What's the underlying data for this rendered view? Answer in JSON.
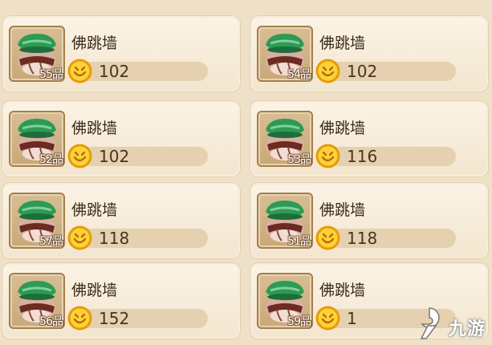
{
  "items": [
    {
      "name": "佛跳墙",
      "grade": "55品",
      "price": "102"
    },
    {
      "name": "佛跳墙",
      "grade": "54品",
      "price": "102"
    },
    {
      "name": "佛跳墙",
      "grade": "52品",
      "price": "102"
    },
    {
      "name": "佛跳墙",
      "grade": "53品",
      "price": "116"
    },
    {
      "name": "佛跳墙",
      "grade": "57品",
      "price": "118"
    },
    {
      "name": "佛跳墙",
      "grade": "51品",
      "price": "118"
    },
    {
      "name": "佛跳墙",
      "grade": "56品",
      "price": "152"
    },
    {
      "name": "佛跳墙",
      "grade": "59品",
      "price": "1"
    }
  ],
  "watermark": {
    "text": "九游"
  },
  "icons": {
    "item": "clay-pot-icon",
    "currency": "gold-coin-icon",
    "watermark_logo": "nine-game-logo-icon"
  },
  "colors": {
    "card_bg": "#fbf3e5",
    "price_bar": "#e5d1b0",
    "lid_green": "#2e9a55",
    "coin_gold": "#f2b705"
  }
}
